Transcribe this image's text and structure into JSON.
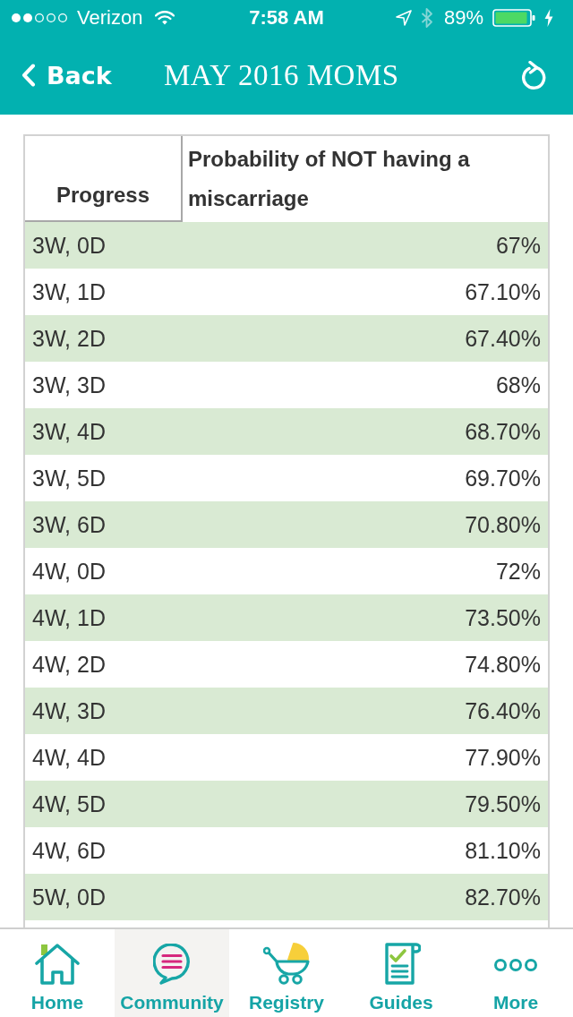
{
  "status_bar": {
    "carrier": "Verizon",
    "time": "7:58 AM",
    "battery": "89%"
  },
  "nav_bar": {
    "back": "Back",
    "title": "MAY 2016 MOMS"
  },
  "table": {
    "columns": [
      "Progress",
      "Probability of NOT having a miscarriage"
    ],
    "rows": [
      {
        "progress": "3W, 0D",
        "probability": "67%"
      },
      {
        "progress": "3W, 1D",
        "probability": "67.10%"
      },
      {
        "progress": "3W, 2D",
        "probability": "67.40%"
      },
      {
        "progress": "3W, 3D",
        "probability": "68%"
      },
      {
        "progress": "3W, 4D",
        "probability": "68.70%"
      },
      {
        "progress": "3W, 5D",
        "probability": "69.70%"
      },
      {
        "progress": "3W, 6D",
        "probability": "70.80%"
      },
      {
        "progress": "4W, 0D",
        "probability": "72%"
      },
      {
        "progress": "4W, 1D",
        "probability": "73.50%"
      },
      {
        "progress": "4W, 2D",
        "probability": "74.80%"
      },
      {
        "progress": "4W, 3D",
        "probability": "76.40%"
      },
      {
        "progress": "4W, 4D",
        "probability": "77.90%"
      },
      {
        "progress": "4W, 5D",
        "probability": "79.50%"
      },
      {
        "progress": "4W, 6D",
        "probability": "81.10%"
      },
      {
        "progress": "5W, 0D",
        "probability": "82.70%"
      }
    ]
  },
  "tab_bar": [
    {
      "label": "Home",
      "selected": false
    },
    {
      "label": "Community",
      "selected": true
    },
    {
      "label": "Registry",
      "selected": false
    },
    {
      "label": "Guides",
      "selected": false
    },
    {
      "label": "More",
      "selected": false
    }
  ]
}
